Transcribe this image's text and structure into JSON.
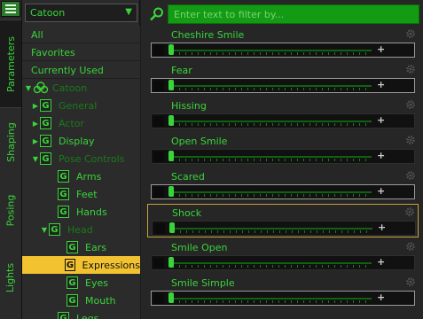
{
  "vertical_tabs": [
    "Parameters",
    "Shaping",
    "Posing",
    "Lights"
  ],
  "preset": {
    "value": "Catoon"
  },
  "filters": [
    "All",
    "Favorites",
    "Currently Used"
  ],
  "tree": [
    {
      "label": "Catoon",
      "toggle": "▼",
      "icon": "cloud",
      "state": "dim"
    },
    {
      "label": "General",
      "toggle": "▶",
      "icon": "G",
      "state": "dim"
    },
    {
      "label": "Actor",
      "toggle": "▶",
      "icon": "G",
      "state": "dim"
    },
    {
      "label": "Display",
      "toggle": "▶",
      "icon": "G",
      "state": "normal"
    },
    {
      "label": "Pose Controls",
      "toggle": "▼",
      "icon": "G",
      "state": "dim"
    },
    {
      "label": "Arms",
      "toggle": "",
      "icon": "G",
      "state": "normal"
    },
    {
      "label": "Feet",
      "toggle": "",
      "icon": "G",
      "state": "normal"
    },
    {
      "label": "Hands",
      "toggle": "",
      "icon": "G",
      "state": "normal"
    },
    {
      "label": "Head",
      "toggle": "▼",
      "icon": "G",
      "state": "dim"
    },
    {
      "label": "Ears",
      "toggle": "",
      "icon": "G",
      "state": "normal"
    },
    {
      "label": "Expressions",
      "toggle": "",
      "icon": "G",
      "state": "selected"
    },
    {
      "label": "Eyes",
      "toggle": "",
      "icon": "G",
      "state": "normal"
    },
    {
      "label": "Mouth",
      "toggle": "",
      "icon": "G",
      "state": "normal"
    },
    {
      "label": "Legs",
      "toggle": "",
      "icon": "G",
      "state": "normal"
    }
  ],
  "filter_input": {
    "placeholder": "Enter text to filter by..."
  },
  "parameters": [
    {
      "name": "Cheshire Smile",
      "state": "boxed"
    },
    {
      "name": "Fear",
      "state": "boxed"
    },
    {
      "name": "Hissing",
      "state": "plain"
    },
    {
      "name": "Open Smile",
      "state": "plain"
    },
    {
      "name": "Scared",
      "state": "boxed"
    },
    {
      "name": "Shock",
      "state": "highlight"
    },
    {
      "name": "Smile Open",
      "state": "plain"
    },
    {
      "name": "Smile Simple",
      "state": "boxed"
    }
  ],
  "colors": {
    "accent_green": "#39d439",
    "selection_yellow": "#f2c230",
    "filter_green": "#139b13"
  }
}
